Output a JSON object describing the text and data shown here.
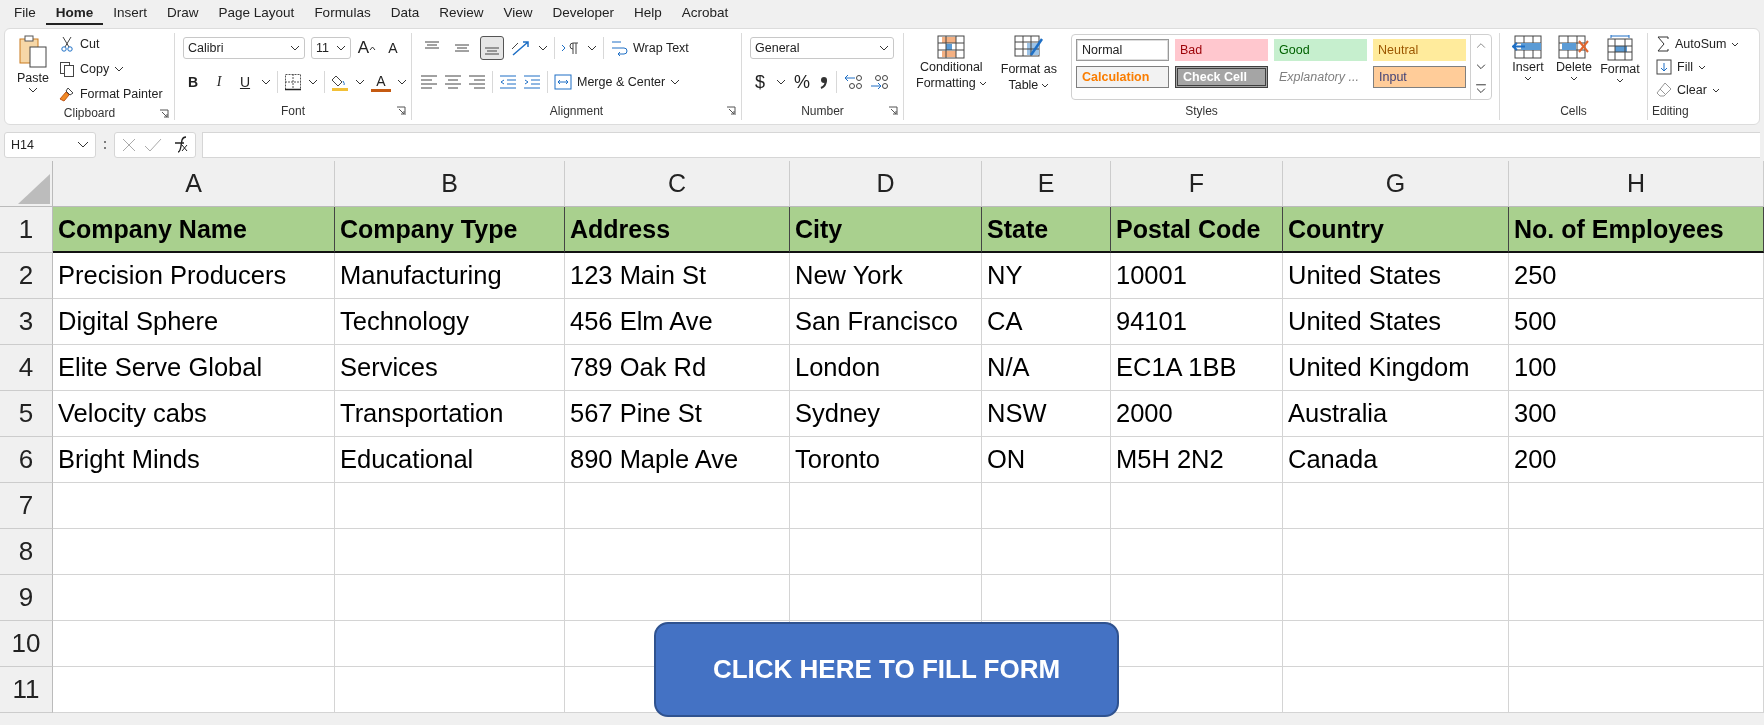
{
  "menu_tabs": [
    {
      "label": "File",
      "selected": false
    },
    {
      "label": "Home",
      "selected": true
    },
    {
      "label": "Insert",
      "selected": false
    },
    {
      "label": "Draw",
      "selected": false
    },
    {
      "label": "Page Layout",
      "selected": false
    },
    {
      "label": "Formulas",
      "selected": false
    },
    {
      "label": "Data",
      "selected": false
    },
    {
      "label": "Review",
      "selected": false
    },
    {
      "label": "View",
      "selected": false
    },
    {
      "label": "Developer",
      "selected": false
    },
    {
      "label": "Help",
      "selected": false
    },
    {
      "label": "Acrobat",
      "selected": false
    }
  ],
  "ribbon": {
    "clipboard": {
      "paste": "Paste",
      "cut": "Cut",
      "copy": "Copy",
      "format_painter": "Format Painter",
      "label": "Clipboard"
    },
    "font": {
      "name": "Calibri",
      "size": "11",
      "grow": "A",
      "shrink": "A",
      "bold": "B",
      "italic": "I",
      "underline": "U",
      "color_letter": "A",
      "label": "Font"
    },
    "alignment": {
      "vertical": [
        {
          "selected": false
        },
        {
          "selected": false
        },
        {
          "selected": true
        }
      ],
      "wrap_text": "Wrap Text",
      "merge_center": "Merge & Center",
      "label": "Alignment"
    },
    "number": {
      "format": "General",
      "currency": "$",
      "percent": "%",
      "label": "Number"
    },
    "styles": {
      "conditional": [
        "Conditional",
        "Formatting"
      ],
      "format_table": [
        "Format as",
        "Table"
      ],
      "gallery": [
        {
          "label": "Normal",
          "kind": "normal"
        },
        {
          "label": "Bad",
          "kind": "bad"
        },
        {
          "label": "Good",
          "kind": "good"
        },
        {
          "label": "Neutral",
          "kind": "neutral"
        },
        {
          "label": "Calculation",
          "kind": "calculation"
        },
        {
          "label": "Check Cell",
          "kind": "check"
        },
        {
          "label": "Explanatory ...",
          "kind": "explanatory"
        },
        {
          "label": "Input",
          "kind": "input"
        }
      ],
      "label": "Styles"
    },
    "cells": {
      "insert": "Insert",
      "delete": "Delete",
      "format": "Format",
      "label": "Cells"
    },
    "editing": {
      "autosum": "AutoSum",
      "fill": "Fill",
      "clear": "Clear",
      "label": "Editing"
    }
  },
  "name_box": "H14",
  "sheet": {
    "columns": [
      "A",
      "B",
      "C",
      "D",
      "E",
      "F",
      "G",
      "H"
    ],
    "header_row": {
      "number": "1",
      "cells": [
        "Company Name",
        "Company Type",
        "Address",
        "City",
        "State",
        "Postal Code",
        "Country",
        "No. of Employees"
      ]
    },
    "rows": [
      {
        "number": "2",
        "cells": [
          "Precision Producers",
          "Manufacturing",
          "123 Main St",
          "New York",
          "NY",
          "10001",
          "United States",
          "250"
        ]
      },
      {
        "number": "3",
        "cells": [
          "Digital Sphere",
          "Technology",
          "456 Elm Ave",
          "San Francisco",
          "CA",
          "94101",
          "United States",
          "500"
        ]
      },
      {
        "number": "4",
        "cells": [
          "Elite Serve Global",
          "Services",
          "789 Oak Rd",
          "London",
          "N/A",
          "EC1A 1BB",
          "United Kingdom",
          "100"
        ]
      },
      {
        "number": "5",
        "cells": [
          "Velocity cabs",
          "Transportation",
          "567 Pine St",
          "Sydney",
          "NSW",
          "2000",
          "Australia",
          "300"
        ]
      },
      {
        "number": "6",
        "cells": [
          "Bright Minds",
          "Educational",
          "890 Maple Ave",
          "Toronto",
          "ON",
          "M5H 2N2",
          "Canada",
          "200"
        ]
      },
      {
        "number": "7",
        "cells": [
          "",
          "",
          "",
          "",
          "",
          "",
          "",
          ""
        ]
      },
      {
        "number": "8",
        "cells": [
          "",
          "",
          "",
          "",
          "",
          "",
          "",
          ""
        ]
      },
      {
        "number": "9",
        "cells": [
          "",
          "",
          "",
          "",
          "",
          "",
          "",
          ""
        ]
      },
      {
        "number": "10",
        "cells": [
          "",
          "",
          "",
          "",
          "",
          "",
          "",
          ""
        ]
      },
      {
        "number": "11",
        "cells": [
          "",
          "",
          "",
          "",
          "",
          "",
          "",
          ""
        ]
      }
    ]
  },
  "form_button": "CLICK HERE TO FILL FORM"
}
